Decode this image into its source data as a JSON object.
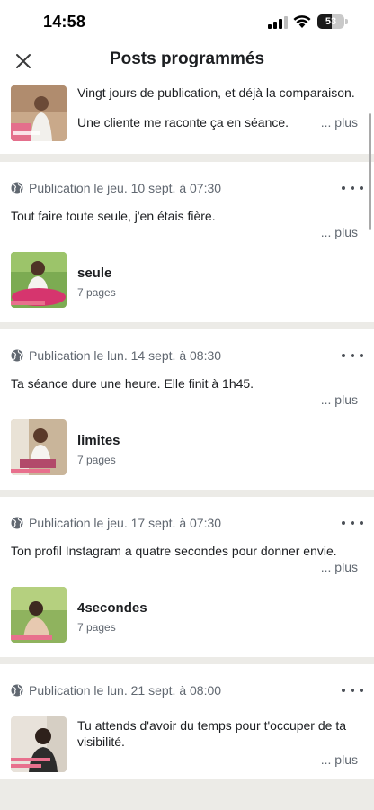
{
  "status_bar": {
    "time": "14:58",
    "battery": "53",
    "battery_level": 0.53
  },
  "nav": {
    "title": "Posts programmés",
    "close_icon": "close-icon"
  },
  "first_post": {
    "line1": "Vingt jours de publication, et déjà la comparaison.",
    "line2": "Une cliente me raconte ça en séance.",
    "more": "... plus"
  },
  "posts": [
    {
      "date": "Publication le jeu. 10 sept. à 07:30",
      "text": "Tout faire toute seule, j'en étais fière.",
      "more": "... plus",
      "item_title": "seule",
      "item_pages": "7 pages"
    },
    {
      "date": "Publication le lun. 14 sept. à 08:30",
      "text": "Ta séance dure une heure. Elle finit à 1h45.",
      "more": "... plus",
      "item_title": "limites",
      "item_pages": "7 pages"
    },
    {
      "date": "Publication le jeu. 17 sept. à 07:30",
      "text": "Ton profil Instagram a quatre secondes pour donner envie.",
      "more": "... plus",
      "item_title": "4secondes",
      "item_pages": "7 pages"
    },
    {
      "date": "Publication le lun. 21 sept. à 08:00",
      "text": "Tu attends d'avoir du temps pour t'occuper de ta visibilité.",
      "more": "... plus"
    }
  ],
  "colors": {
    "background": "#ecebe7",
    "card": "#ffffff",
    "secondary_text": "#606770",
    "primary_text": "#1c1e21"
  }
}
